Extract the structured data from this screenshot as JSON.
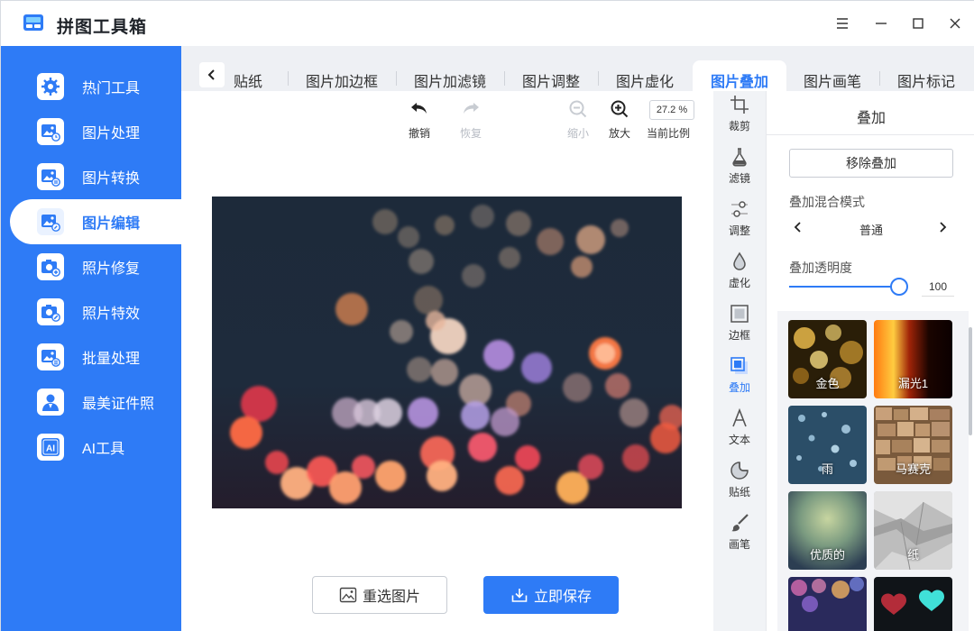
{
  "app": {
    "title": "拼图工具箱"
  },
  "colors": {
    "accent": "#2e7bf6",
    "sidebar_bg": "#2e7bf6"
  },
  "sidebar": {
    "items": [
      {
        "label": "热门工具",
        "icon": "gear-icon"
      },
      {
        "label": "图片处理",
        "icon": "image-clock-icon"
      },
      {
        "label": "图片转换",
        "icon": "image-convert-icon"
      },
      {
        "label": "图片编辑",
        "icon": "image-edit-icon",
        "active": true
      },
      {
        "label": "照片修复",
        "icon": "camera-plus-icon"
      },
      {
        "label": "照片特效",
        "icon": "camera-magic-icon"
      },
      {
        "label": "批量处理",
        "icon": "image-batch-icon"
      },
      {
        "label": "最美证件照",
        "icon": "person-icon"
      },
      {
        "label": "AI工具",
        "icon": "ai-icon"
      }
    ]
  },
  "tabs": {
    "items": [
      "贴纸",
      "图片加边框",
      "图片加滤镜",
      "图片调整",
      "图片虚化",
      "图片叠加",
      "图片画笔",
      "图片标记"
    ],
    "active": "图片叠加"
  },
  "toolbar": {
    "undo": "撤销",
    "redo": "恢复",
    "zoom_out": "缩小",
    "zoom_in": "放大",
    "zoom_value": "27.2 %",
    "zoom_label": "当前比例"
  },
  "actions": {
    "reselect": "重选图片",
    "save": "立即保存"
  },
  "vtools": {
    "items": [
      {
        "label": "裁剪",
        "icon": "crop-icon"
      },
      {
        "label": "滤镜",
        "icon": "filter-flask-icon"
      },
      {
        "label": "调整",
        "icon": "sliders-icon"
      },
      {
        "label": "虚化",
        "icon": "drop-icon"
      },
      {
        "label": "边框",
        "icon": "frame-icon"
      },
      {
        "label": "叠加",
        "icon": "overlay-icon",
        "active": true
      },
      {
        "label": "文本",
        "icon": "text-icon"
      },
      {
        "label": "贴纸",
        "icon": "sticker-icon"
      },
      {
        "label": "画笔",
        "icon": "brush-icon"
      }
    ]
  },
  "panel": {
    "title": "叠加",
    "remove_label": "移除叠加",
    "blend_label": "叠加混合模式",
    "blend_value": "普通",
    "opacity_label": "叠加透明度",
    "opacity_value": "100",
    "overlays": [
      "金色",
      "漏光1",
      "雨",
      "马赛克",
      "优质的",
      "纸"
    ]
  }
}
